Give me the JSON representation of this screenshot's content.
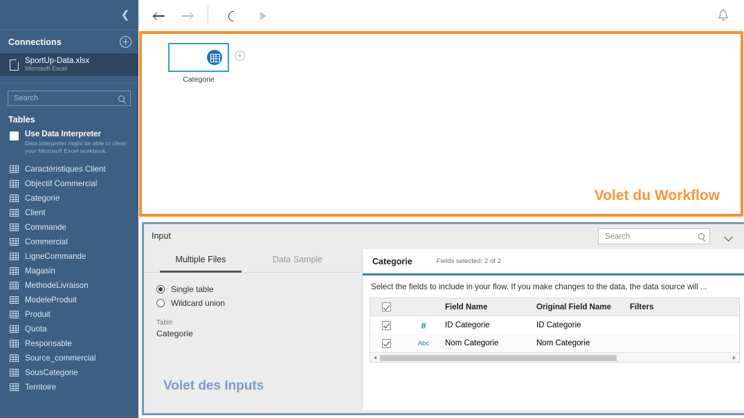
{
  "sidebar": {
    "collapse_icon": "chevron-left-icon",
    "connections_label": "Connections",
    "add_connection_icon": "plus-circle-icon",
    "connection": {
      "name": "SportUp-Data.xlsx",
      "type": "Microsoft Excel",
      "icon": "file-icon"
    },
    "search": {
      "placeholder": "Search",
      "icon": "search-icon"
    },
    "tables_label": "Tables",
    "data_interpreter": {
      "label": "Use Data Interpreter",
      "description": "Data Interpreter might be able to clean your Microsoft Excel workbook.",
      "checked": false
    },
    "tables": [
      "Caractéristiques Client",
      "Objectif Commercial",
      "Categorie",
      "Client",
      "Commande",
      "Commercial",
      "LigneCommande",
      "Magasin",
      "MethodeLivraison",
      "ModeleProduit",
      "Produit",
      "Quota",
      "Responsable",
      "Source_commercial",
      "SousCategorie",
      "Territoire"
    ]
  },
  "toolbar": {
    "back_icon": "arrow-left-icon",
    "forward_icon": "arrow-right-icon",
    "refresh_icon": "refresh-icon",
    "run_icon": "play-icon",
    "notifications_icon": "bell-icon"
  },
  "workflow": {
    "node": {
      "label": "Categorie",
      "icon": "database-table-icon",
      "add_icon": "plus-circle-icon"
    },
    "annotation": "Volet du Workflow",
    "annotation_color": "#f5963a",
    "border_color": "#f5922c"
  },
  "input_pane": {
    "title": "Input",
    "search": {
      "placeholder": "Search",
      "icon": "search-icon"
    },
    "collapse_icon": "chevron-down-icon",
    "annotation": "Volet des Inputs",
    "annotation_color": "#7c9bc6",
    "border_color": "#7796bc",
    "tabs": [
      {
        "label": "Multiple Files",
        "active": true
      },
      {
        "label": "Data Sample",
        "active": false
      }
    ],
    "options": [
      {
        "label": "Single table",
        "selected": true
      },
      {
        "label": "Wildcard union",
        "selected": false
      }
    ],
    "table_field": {
      "label": "Table",
      "value": "Categorie"
    },
    "card": {
      "title": "Categorie",
      "fields_selected": "Fields selected: 2 of 2",
      "description": "Select the fields to include in your flow. If you make changes to the data, the data source will ...",
      "columns": [
        "",
        "",
        "Field Name",
        "Original Field Name",
        "Filters"
      ],
      "header_checked": true,
      "rows": [
        {
          "checked": true,
          "type": "#",
          "type_kind": "number",
          "field_name": "ID Categorie",
          "original_field_name": "ID Categorie",
          "filters": ""
        },
        {
          "checked": true,
          "type": "Abc",
          "type_kind": "string",
          "field_name": "Nom Categorie",
          "original_field_name": "Nom Categorie",
          "filters": ""
        }
      ]
    }
  }
}
